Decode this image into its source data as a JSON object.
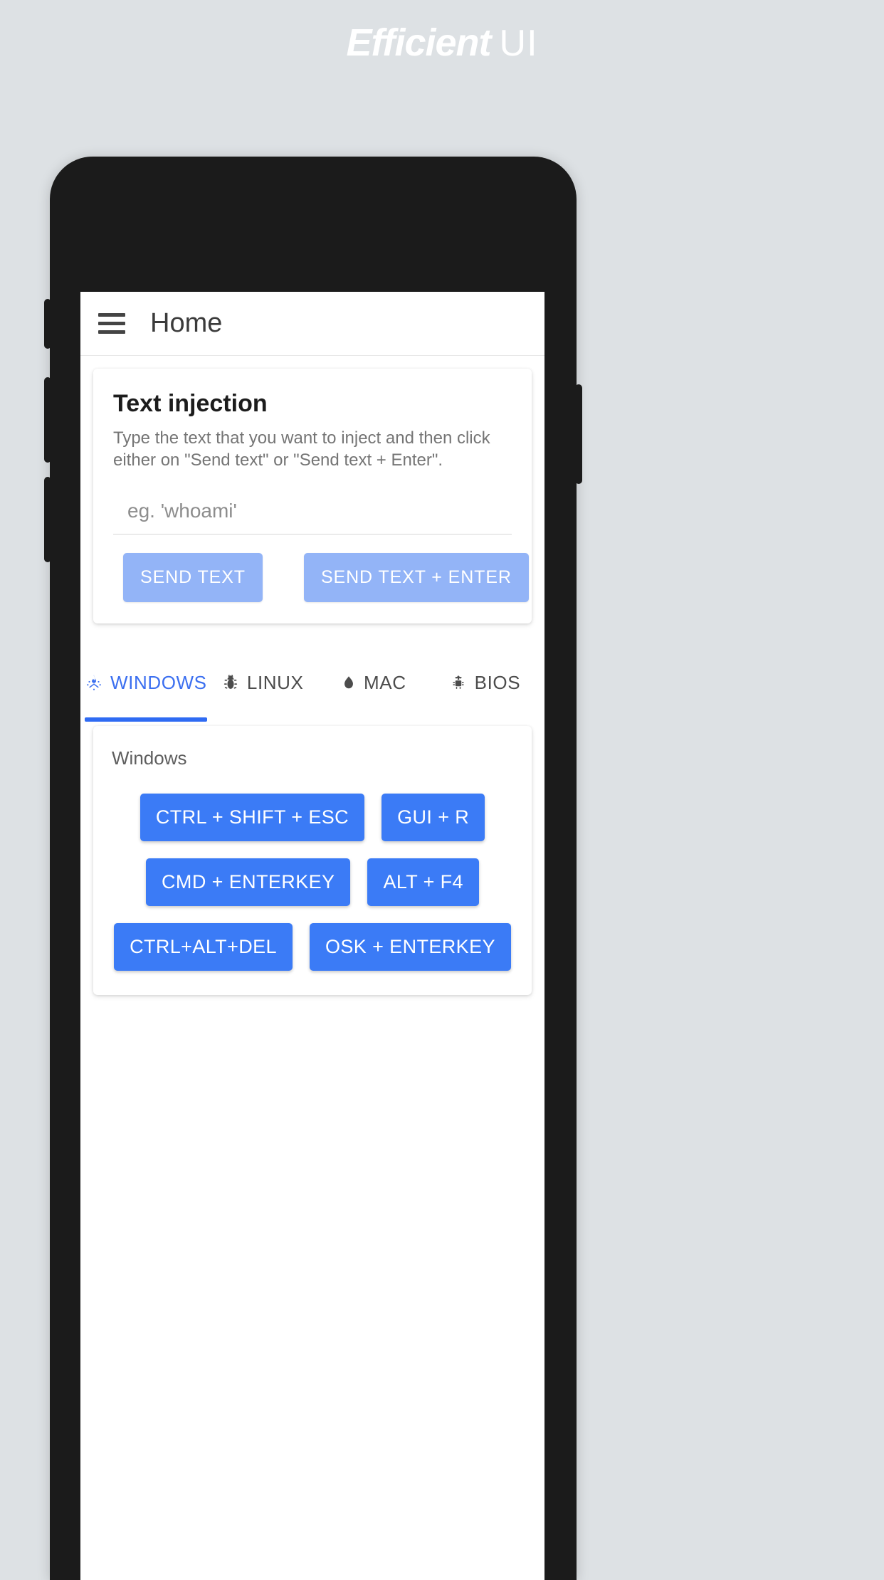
{
  "promo": {
    "title_strong": "Efficient",
    "title_light": "UI"
  },
  "app_bar": {
    "menu_icon": "hamburger-menu-icon",
    "title": "Home"
  },
  "text_injection_card": {
    "title": "Text injection",
    "description": "Type the text that you want to inject and then click either on \"Send text\" or \"Send text + Enter\".",
    "input_value": "",
    "input_placeholder": "eg. 'whoami'",
    "send_text_label": "SEND TEXT",
    "send_text_enter_label": "SEND TEXT + ENTER"
  },
  "tabs": {
    "active_index": 0,
    "active_color": "#3b6ff0",
    "inactive_color": "#4c4c4c",
    "indicator_color": "#2f6bf3",
    "items": [
      {
        "label": "WINDOWS",
        "icon": "campfire-icon"
      },
      {
        "label": "LINUX",
        "icon": "bug-icon"
      },
      {
        "label": "MAC",
        "icon": "flame-icon"
      },
      {
        "label": "BIOS",
        "icon": "chip-icon"
      }
    ]
  },
  "shortcut_card": {
    "title": "Windows",
    "button_color": "#3b7bf6",
    "rows": [
      [
        "CTRL + SHIFT + ESC",
        "GUI + R"
      ],
      [
        "CMD + ENTERKEY",
        "ALT + F4"
      ],
      [
        "CTRL+ALT+DEL",
        "OSK + ENTERKEY"
      ]
    ]
  }
}
